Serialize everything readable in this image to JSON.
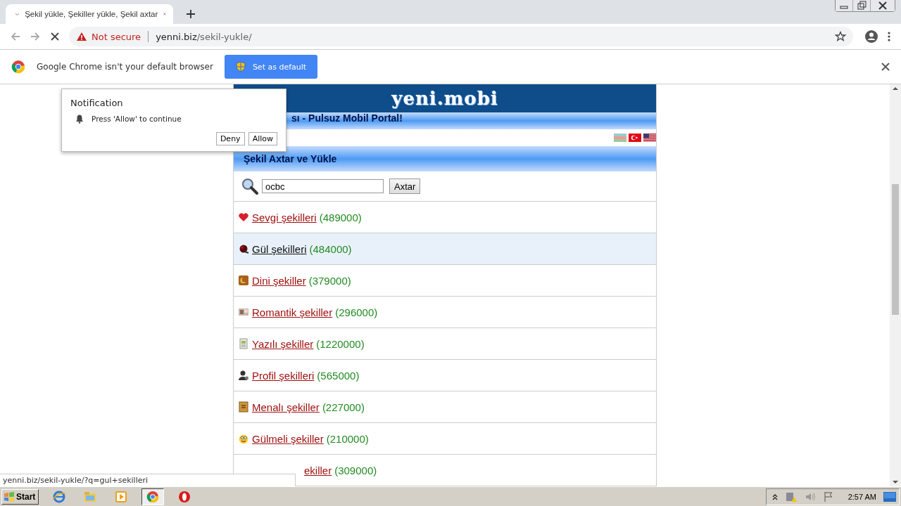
{
  "window": {
    "tab_title": "Şekil yükle, Şekiller yükle, Şekil axtar",
    "security": "Not secure",
    "url_host": "yenni.biz",
    "url_path": "/sekil-yukle/"
  },
  "infobar": {
    "message": "Google Chrome isn't your default browser",
    "button": "Set as default"
  },
  "page": {
    "logo": "yeni.mobi",
    "tagline": "sı - Pulsuz Mobil Portal!",
    "section_title": "Şekil Axtar ve Yükle",
    "search": {
      "value": "ocbc",
      "button": "Axtar"
    },
    "categories": [
      {
        "label": "Sevgi şekilleri",
        "count": "(489000)",
        "hovered": false
      },
      {
        "label": "Gül şekilleri",
        "count": "(484000)",
        "hovered": true
      },
      {
        "label": "Dini şekiller",
        "count": "(379000)",
        "hovered": false
      },
      {
        "label": "Romantik şekiller",
        "count": "(296000)",
        "hovered": false
      },
      {
        "label": "Yazılı şekiller",
        "count": "(1220000)",
        "hovered": false
      },
      {
        "label": "Profil şekilleri",
        "count": "(565000)",
        "hovered": false
      },
      {
        "label": "Menalı şekiller",
        "count": "(227000)",
        "hovered": false
      },
      {
        "label": "Gülmeli şekiller",
        "count": "(210000)",
        "hovered": false
      },
      {
        "label": "ekiller",
        "count": "(309000)",
        "hovered": false,
        "kind": "partial"
      }
    ]
  },
  "notification": {
    "title": "Notification",
    "message": "Press 'Allow' to continue",
    "buttons": [
      "Deny",
      "Allow"
    ]
  },
  "status_bar": "yenni.biz/sekil-yukle/?q=gul+sekilleri",
  "taskbar": {
    "start": "Start",
    "clock": "2:57 AM"
  }
}
